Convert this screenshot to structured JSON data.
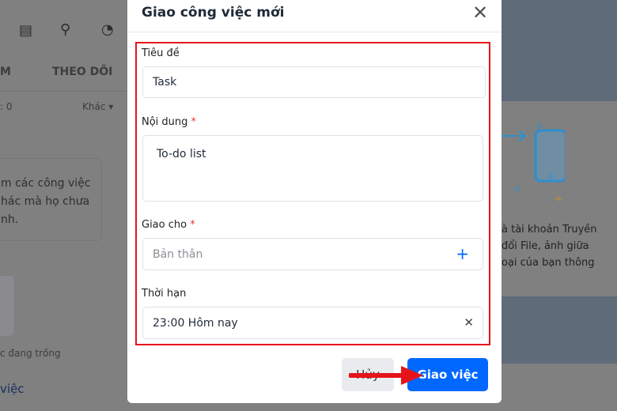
{
  "background": {
    "left_tabs": [
      "M",
      "THEO DÕI"
    ],
    "count_text": ": 0",
    "filter_label": "Khác",
    "info_lines": [
      "m các công việc",
      "hác mà họ chưa",
      "nh."
    ],
    "empty_text": "c đang trống",
    "link_text": "việc",
    "right_lines": [
      "à tài khoản Truyền",
      "đổi File, ảnh giữa",
      "oại của bạn thông"
    ]
  },
  "modal": {
    "title": "Giao công việc mới",
    "fields": {
      "title": {
        "label": "Tiêu đề",
        "value": "Task"
      },
      "content": {
        "label": "Nội dung",
        "required": "*",
        "value": "To-do list"
      },
      "assignee": {
        "label": "Giao cho",
        "required": "*",
        "placeholder": "Bản thân"
      },
      "deadline": {
        "label": "Thời hạn",
        "value": "23:00 Hôm nay"
      }
    },
    "cancel_label": "Hủy",
    "submit_label": "Giao việc"
  },
  "colors": {
    "accent": "#0068ff",
    "highlight": "#e5141b"
  }
}
